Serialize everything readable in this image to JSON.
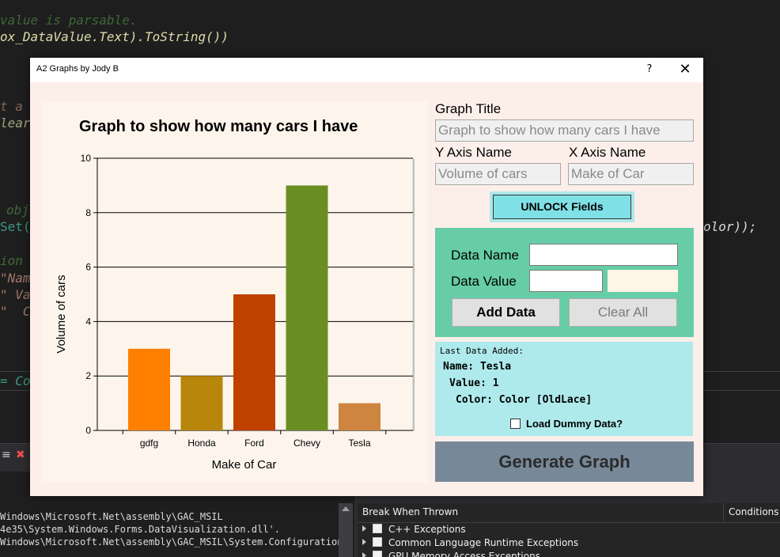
{
  "ide": {
    "code_lines": [
      "value is parsable.",
      "ox_DataValue.Text).ToString())",
      "t a",
      "lear",
      "obj",
      "Set(",
      "olor));",
      "ion",
      "\"Nam",
      "\" Va",
      "\"  C",
      "= Co"
    ],
    "output_lines": [
      "Windows\\Microsoft.Net\\assembly\\GAC_MSIL",
      "4e35\\System.Windows.Forms.DataVisualization.dll'.",
      "Windows\\Microsoft.Net\\assembly\\GAC_MSIL\\System.Configuration"
    ],
    "exceptions_header": "Break When Thrown",
    "conditions_header": "Conditions",
    "exceptions": [
      "C++ Exceptions",
      "Common Language Runtime Exceptions",
      "GPU Memory Access Exceptions"
    ]
  },
  "window": {
    "title": "A2 Graphs by Jody B",
    "help": "?",
    "close": "✕"
  },
  "form": {
    "graph_title_label": "Graph Title",
    "graph_title_value": "Graph to show how many cars I have",
    "y_axis_label": "Y Axis Name",
    "y_axis_value": "Volume of cars",
    "x_axis_label": "X Axis Name",
    "x_axis_value": "Make of Car",
    "unlock_button": "UNLOCK Fields",
    "data_name_label": "Data Name",
    "data_value_label": "Data Value",
    "data_name_value": "",
    "data_value_value": "",
    "add_data_button": "Add Data",
    "clear_all_button": "Clear All",
    "last_added_heading": "Last Data Added:",
    "last_name": "Name: Tesla",
    "last_value": "Value: 1",
    "last_color": "Color: Color [OldLace]",
    "dummy_checkbox_label": "Load Dummy Data?",
    "dummy_checked": false,
    "generate_button": "Generate Graph"
  },
  "colors": {
    "accent_green": "#66cda7",
    "info_cyan": "#aeeaec",
    "generate_slate": "#778899",
    "swatch_oldlace": "#fdf5e6"
  },
  "chart_data": {
    "type": "bar",
    "title": "Graph to show how many cars I have",
    "xlabel": "Make of Car",
    "ylabel": "Volume of cars",
    "categories": [
      "gdfg",
      "Honda",
      "Ford",
      "Chevy",
      "Tesla"
    ],
    "values": [
      3,
      2,
      5,
      9,
      1
    ],
    "bar_colors": [
      "#ff8000",
      "#b8860b",
      "#c04000",
      "#6b8e23",
      "#cd853f"
    ],
    "ylim": [
      0,
      10
    ],
    "yticks": [
      0,
      2,
      4,
      6,
      8,
      10
    ],
    "grid": true,
    "legend": "none"
  }
}
